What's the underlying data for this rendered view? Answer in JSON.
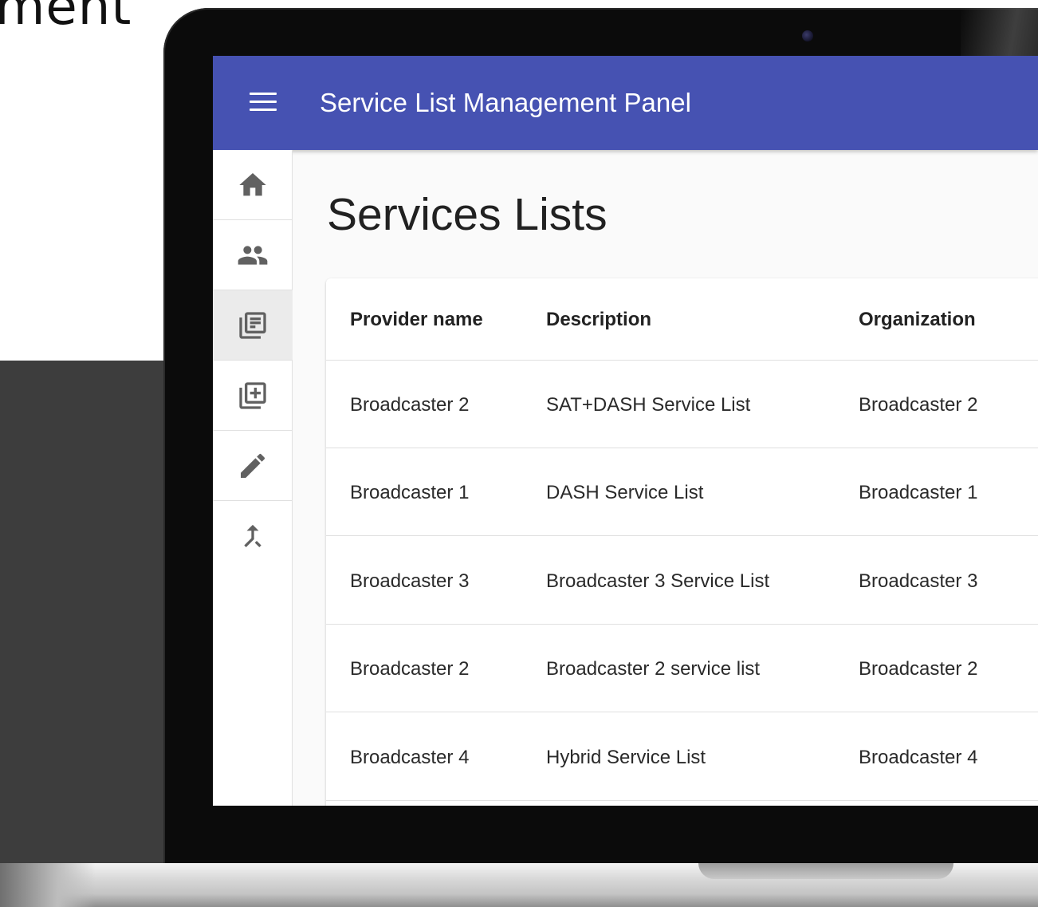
{
  "background": {
    "cropped_heading": "ment"
  },
  "appbar": {
    "title": "Service List Management Panel",
    "menu_icon": "menu-icon"
  },
  "sidenav": {
    "items": [
      {
        "icon": "home-icon",
        "active": false
      },
      {
        "icon": "people-icon",
        "active": false
      },
      {
        "icon": "library-books-icon",
        "active": true
      },
      {
        "icon": "library-add-icon",
        "active": false
      },
      {
        "icon": "edit-icon",
        "active": false
      },
      {
        "icon": "merge-icon",
        "active": false
      }
    ]
  },
  "main": {
    "page_title": "Services Lists",
    "table": {
      "headers": [
        "Provider name",
        "Description",
        "Organization"
      ],
      "rows": [
        [
          "Broadcaster 2",
          "SAT+DASH Service List",
          "Broadcaster 2"
        ],
        [
          "Broadcaster 1",
          "DASH Service List",
          "Broadcaster 1"
        ],
        [
          "Broadcaster 3",
          "Broadcaster 3 Service List",
          "Broadcaster 3"
        ],
        [
          "Broadcaster 2",
          "Broadcaster 2 service list",
          "Broadcaster 2"
        ],
        [
          "Broadcaster 4",
          "Hybrid Service List",
          "Broadcaster 4"
        ]
      ]
    }
  },
  "colors": {
    "appbar": "#4652b2",
    "icon": "#616161"
  }
}
